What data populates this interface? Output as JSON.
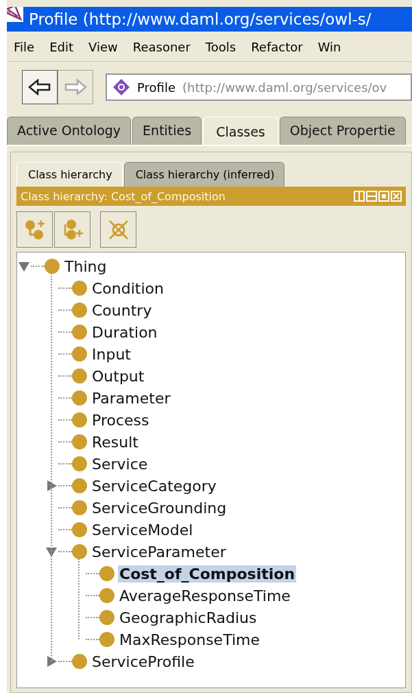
{
  "window": {
    "title": "Profile (http://www.daml.org/services/owl-s/"
  },
  "menu": [
    "File",
    "Edit",
    "View",
    "Reasoner",
    "Tools",
    "Refactor",
    "Win"
  ],
  "toolbar": {
    "back_disabled": false,
    "forward_disabled": true,
    "address": {
      "name": "Profile",
      "iri": "(http://www.daml.org/services/ov"
    }
  },
  "tabs": [
    {
      "label": "Active Ontology",
      "selected": false
    },
    {
      "label": "Entities",
      "selected": false
    },
    {
      "label": "Classes",
      "selected": true
    },
    {
      "label": "Object Propertie",
      "selected": false
    }
  ],
  "subtabs": [
    {
      "label": "Class hierarchy",
      "selected": true
    },
    {
      "label": "Class hierarchy (inferred)",
      "selected": false
    }
  ],
  "view": {
    "title": "Class hierarchy: Cost_of_Composition"
  },
  "tree": [
    {
      "label": "Thing",
      "selected": false,
      "expanded": true,
      "children": [
        {
          "label": "Condition",
          "selected": false
        },
        {
          "label": "Country",
          "selected": false
        },
        {
          "label": "Duration",
          "selected": false
        },
        {
          "label": "Input",
          "selected": false
        },
        {
          "label": "Output",
          "selected": false
        },
        {
          "label": "Parameter",
          "selected": false
        },
        {
          "label": "Process",
          "selected": false
        },
        {
          "label": "Result",
          "selected": false
        },
        {
          "label": "Service",
          "selected": false
        },
        {
          "label": "ServiceCategory",
          "selected": false,
          "expanded": false
        },
        {
          "label": "ServiceGrounding",
          "selected": false
        },
        {
          "label": "ServiceModel",
          "selected": false
        },
        {
          "label": "ServiceParameter",
          "selected": false,
          "expanded": true,
          "children": [
            {
              "label": "Cost_of_Composition",
              "selected": true
            },
            {
              "label": "AverageResponseTime",
              "selected": false
            },
            {
              "label": "GeographicRadius",
              "selected": false
            },
            {
              "label": "MaxResponseTime",
              "selected": false
            }
          ]
        },
        {
          "label": "ServiceProfile",
          "selected": false,
          "expanded": false
        }
      ]
    }
  ]
}
